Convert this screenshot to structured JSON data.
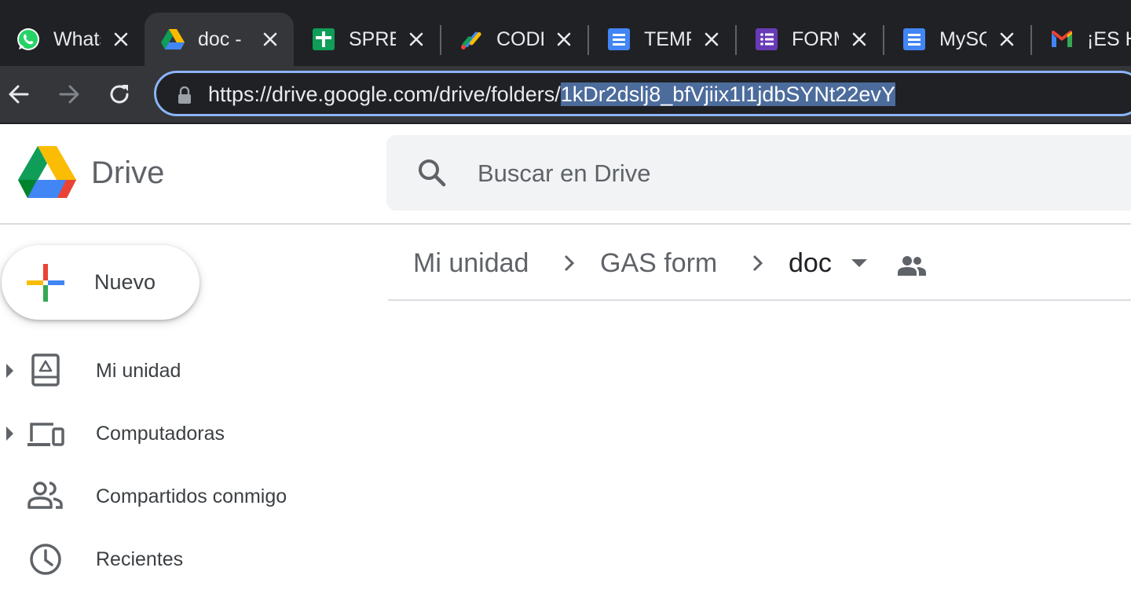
{
  "browser": {
    "tabs": [
      {
        "title": "WhatsApp",
        "icon": "whatsapp-icon",
        "active": false
      },
      {
        "title": "doc - Google Drive",
        "icon": "google-drive-icon",
        "active": true
      },
      {
        "title": "SPREADSHEET",
        "icon": "google-sheets-icon",
        "active": false
      },
      {
        "title": "CODE",
        "icon": "apps-script-icon",
        "active": false
      },
      {
        "title": "TEMPLATE",
        "icon": "google-docs-icon",
        "active": false
      },
      {
        "title": "FORM",
        "icon": "google-forms-icon",
        "active": false
      },
      {
        "title": "MySQL",
        "icon": "google-docs-icon",
        "active": false
      },
      {
        "title": "¡ES HORA",
        "icon": "gmail-icon",
        "active": false
      }
    ],
    "url_prefix": "https://drive.google.com/drive/folders/",
    "url_selected": "1kDr2dslj8_bfVjiix1l1jdbSYNt22evY"
  },
  "drive": {
    "app_name": "Drive",
    "search_placeholder": "Buscar en Drive",
    "new_button_label": "Nuevo",
    "sidebar": {
      "items": [
        {
          "label": "Mi unidad",
          "icon": "my-drive-icon",
          "expandable": true
        },
        {
          "label": "Computadoras",
          "icon": "computers-icon",
          "expandable": true
        },
        {
          "label": "Compartidos conmigo",
          "icon": "shared-with-me-icon",
          "expandable": false
        },
        {
          "label": "Recientes",
          "icon": "clock-icon",
          "expandable": false
        }
      ]
    },
    "breadcrumb": {
      "items": [
        "Mi unidad",
        "GAS form",
        "doc"
      ]
    }
  },
  "colors": {
    "tabstrip": "#202124",
    "toolbar": "#35363a",
    "omnibox_focus": "#8ab4f8",
    "url_selection": "#4c6c9c",
    "search_bg": "#f1f3f4",
    "text_secondary": "#5f6368",
    "text_primary": "#202124"
  }
}
